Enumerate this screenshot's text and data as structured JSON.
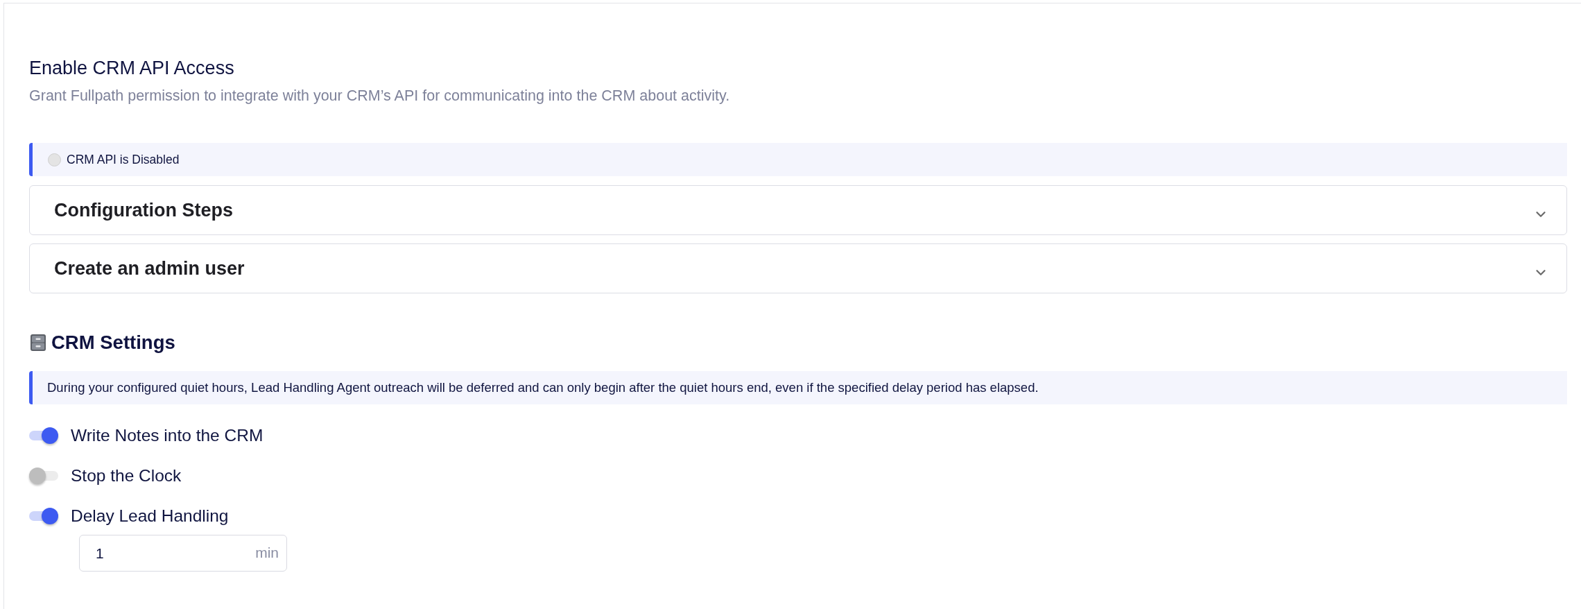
{
  "header": {
    "title": "Enable CRM API Access",
    "description": "Grant Fullpath permission to integrate with your CRM’s API for communicating into the CRM about activity."
  },
  "status_banner": {
    "text": "CRM API is Disabled",
    "on": false
  },
  "accordions": [
    {
      "title": "Configuration Steps",
      "expanded": false
    },
    {
      "title": "Create an admin user",
      "expanded": false
    }
  ],
  "settings": {
    "title": "CRM Settings",
    "notice": "During your configured quiet hours, Lead Handling Agent outreach will be deferred and can only begin after the quiet hours end, even if the specified delay period has elapsed.",
    "toggles": [
      {
        "label": "Write Notes into the CRM",
        "on": true
      },
      {
        "label": "Stop the Clock",
        "on": false
      },
      {
        "label": "Delay Lead Handling",
        "on": true
      }
    ],
    "delay_field": {
      "value": "1",
      "unit": "min"
    }
  }
}
